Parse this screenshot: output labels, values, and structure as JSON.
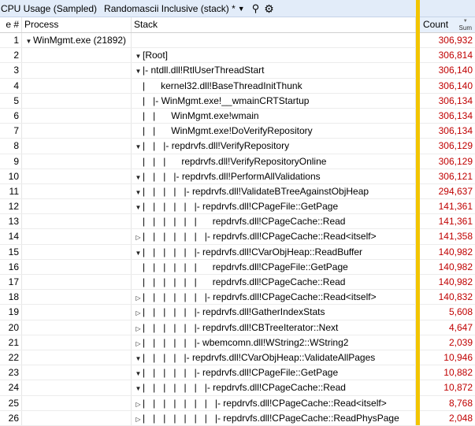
{
  "toolbar": {
    "title": "CPU Usage (Sampled)",
    "view": "Randomascii Inclusive (stack) *",
    "view_caret": "▼",
    "search_icon": "⚲",
    "settings_icon": "⚙"
  },
  "columns": {
    "line": "e #",
    "process": "Process",
    "stack": "Stack",
    "count": "Count",
    "count_sort_icon": "▼",
    "count_agg": "Sum"
  },
  "colors": {
    "accent_divider": "#f2c500",
    "count_text": "#c00000",
    "titlebar_bg": "#e2ecf9"
  },
  "rows": [
    {
      "num": "1",
      "process": "WinMgmt.exe (21892)",
      "process_exp": "▼",
      "level": 0,
      "exp": "",
      "pipes": "",
      "stack": "",
      "count": "306,932"
    },
    {
      "num": "2",
      "process": "",
      "process_exp": "",
      "level": 0,
      "exp": "▼",
      "pipes": "",
      "stack": "[Root]",
      "count": "306,814"
    },
    {
      "num": "3",
      "process": "",
      "process_exp": "",
      "level": 0,
      "exp": "▼",
      "pipes": "|- ",
      "stack": "ntdll.dll!RtlUserThreadStart",
      "count": "306,140"
    },
    {
      "num": "4",
      "process": "",
      "process_exp": "",
      "level": 0,
      "exp": "",
      "pipes": "|      ",
      "stack": "kernel32.dll!BaseThreadInitThunk",
      "count": "306,140"
    },
    {
      "num": "5",
      "process": "",
      "process_exp": "",
      "level": 0,
      "exp": "",
      "pipes": "|   |- ",
      "stack": "WinMgmt.exe!__wmainCRTStartup",
      "count": "306,134"
    },
    {
      "num": "6",
      "process": "",
      "process_exp": "",
      "level": 0,
      "exp": "",
      "pipes": "|   |      ",
      "stack": "WinMgmt.exe!wmain",
      "count": "306,134"
    },
    {
      "num": "7",
      "process": "",
      "process_exp": "",
      "level": 0,
      "exp": "",
      "pipes": "|   |      ",
      "stack": "WinMgmt.exe!DoVerifyRepository",
      "count": "306,134"
    },
    {
      "num": "8",
      "process": "",
      "process_exp": "",
      "level": 0,
      "exp": "▼",
      "pipes": "|   |   |- ",
      "stack": "repdrvfs.dll!VerifyRepository",
      "count": "306,129"
    },
    {
      "num": "9",
      "process": "",
      "process_exp": "",
      "level": 0,
      "exp": "",
      "pipes": "|   |   |      ",
      "stack": "repdrvfs.dll!VerifyRepositoryOnline",
      "count": "306,129"
    },
    {
      "num": "10",
      "process": "",
      "process_exp": "",
      "level": 0,
      "exp": "▼",
      "pipes": "|   |   |   |- ",
      "stack": "repdrvfs.dll!PerformAllValidations",
      "count": "306,121"
    },
    {
      "num": "11",
      "process": "",
      "process_exp": "",
      "level": 0,
      "exp": "▼",
      "pipes": "|   |   |   |   |- ",
      "stack": "repdrvfs.dll!ValidateBTreeAgainstObjHeap",
      "count": "294,637"
    },
    {
      "num": "12",
      "process": "",
      "process_exp": "",
      "level": 0,
      "exp": "▼",
      "pipes": "|   |   |   |   |   |- ",
      "stack": "repdrvfs.dll!CPageFile::GetPage",
      "count": "141,361"
    },
    {
      "num": "13",
      "process": "",
      "process_exp": "",
      "level": 0,
      "exp": "",
      "pipes": "|   |   |   |   |   |      ",
      "stack": "repdrvfs.dll!CPageCache::Read",
      "count": "141,361"
    },
    {
      "num": "14",
      "process": "",
      "process_exp": "",
      "level": 0,
      "exp": "▷",
      "pipes": "|   |   |   |   |   |   |- ",
      "stack": "repdrvfs.dll!CPageCache::Read<itself>",
      "count": "141,358"
    },
    {
      "num": "15",
      "process": "",
      "process_exp": "",
      "level": 0,
      "exp": "▼",
      "pipes": "|   |   |   |   |   |- ",
      "stack": "repdrvfs.dll!CVarObjHeap::ReadBuffer",
      "count": "140,982"
    },
    {
      "num": "16",
      "process": "",
      "process_exp": "",
      "level": 0,
      "exp": "",
      "pipes": "|   |   |   |   |   |      ",
      "stack": "repdrvfs.dll!CPageFile::GetPage",
      "count": "140,982"
    },
    {
      "num": "17",
      "process": "",
      "process_exp": "",
      "level": 0,
      "exp": "",
      "pipes": "|   |   |   |   |   |      ",
      "stack": "repdrvfs.dll!CPageCache::Read",
      "count": "140,982"
    },
    {
      "num": "18",
      "process": "",
      "process_exp": "",
      "level": 0,
      "exp": "▷",
      "pipes": "|   |   |   |   |   |   |- ",
      "stack": "repdrvfs.dll!CPageCache::Read<itself>",
      "count": "140,832"
    },
    {
      "num": "19",
      "process": "",
      "process_exp": "",
      "level": 0,
      "exp": "▷",
      "pipes": "|   |   |   |   |   |- ",
      "stack": "repdrvfs.dll!GatherIndexStats",
      "count": "5,608"
    },
    {
      "num": "20",
      "process": "",
      "process_exp": "",
      "level": 0,
      "exp": "▷",
      "pipes": "|   |   |   |   |   |- ",
      "stack": "repdrvfs.dll!CBTreeIterator::Next",
      "count": "4,647"
    },
    {
      "num": "21",
      "process": "",
      "process_exp": "",
      "level": 0,
      "exp": "▷",
      "pipes": "|   |   |   |   |   |- ",
      "stack": "wbemcomn.dll!WString2::WString2",
      "count": "2,039"
    },
    {
      "num": "22",
      "process": "",
      "process_exp": "",
      "level": 0,
      "exp": "▼",
      "pipes": "|   |   |   |   |- ",
      "stack": "repdrvfs.dll!CVarObjHeap::ValidateAllPages",
      "count": "10,946"
    },
    {
      "num": "23",
      "process": "",
      "process_exp": "",
      "level": 0,
      "exp": "▼",
      "pipes": "|   |   |   |   |   |- ",
      "stack": "repdrvfs.dll!CPageFile::GetPage",
      "count": "10,882"
    },
    {
      "num": "24",
      "process": "",
      "process_exp": "",
      "level": 0,
      "exp": "▼",
      "pipes": "|   |   |   |   |   |   |- ",
      "stack": "repdrvfs.dll!CPageCache::Read",
      "count": "10,872"
    },
    {
      "num": "25",
      "process": "",
      "process_exp": "",
      "level": 0,
      "exp": "▷",
      "pipes": "|   |   |   |   |   |   |   |- ",
      "stack": "repdrvfs.dll!CPageCache::Read<itself>",
      "count": "8,768"
    },
    {
      "num": "26",
      "process": "",
      "process_exp": "",
      "level": 0,
      "exp": "▷",
      "pipes": "|   |   |   |   |   |   |   |- ",
      "stack": "repdrvfs.dll!CPageCache::ReadPhysPage",
      "count": "2,048"
    }
  ]
}
